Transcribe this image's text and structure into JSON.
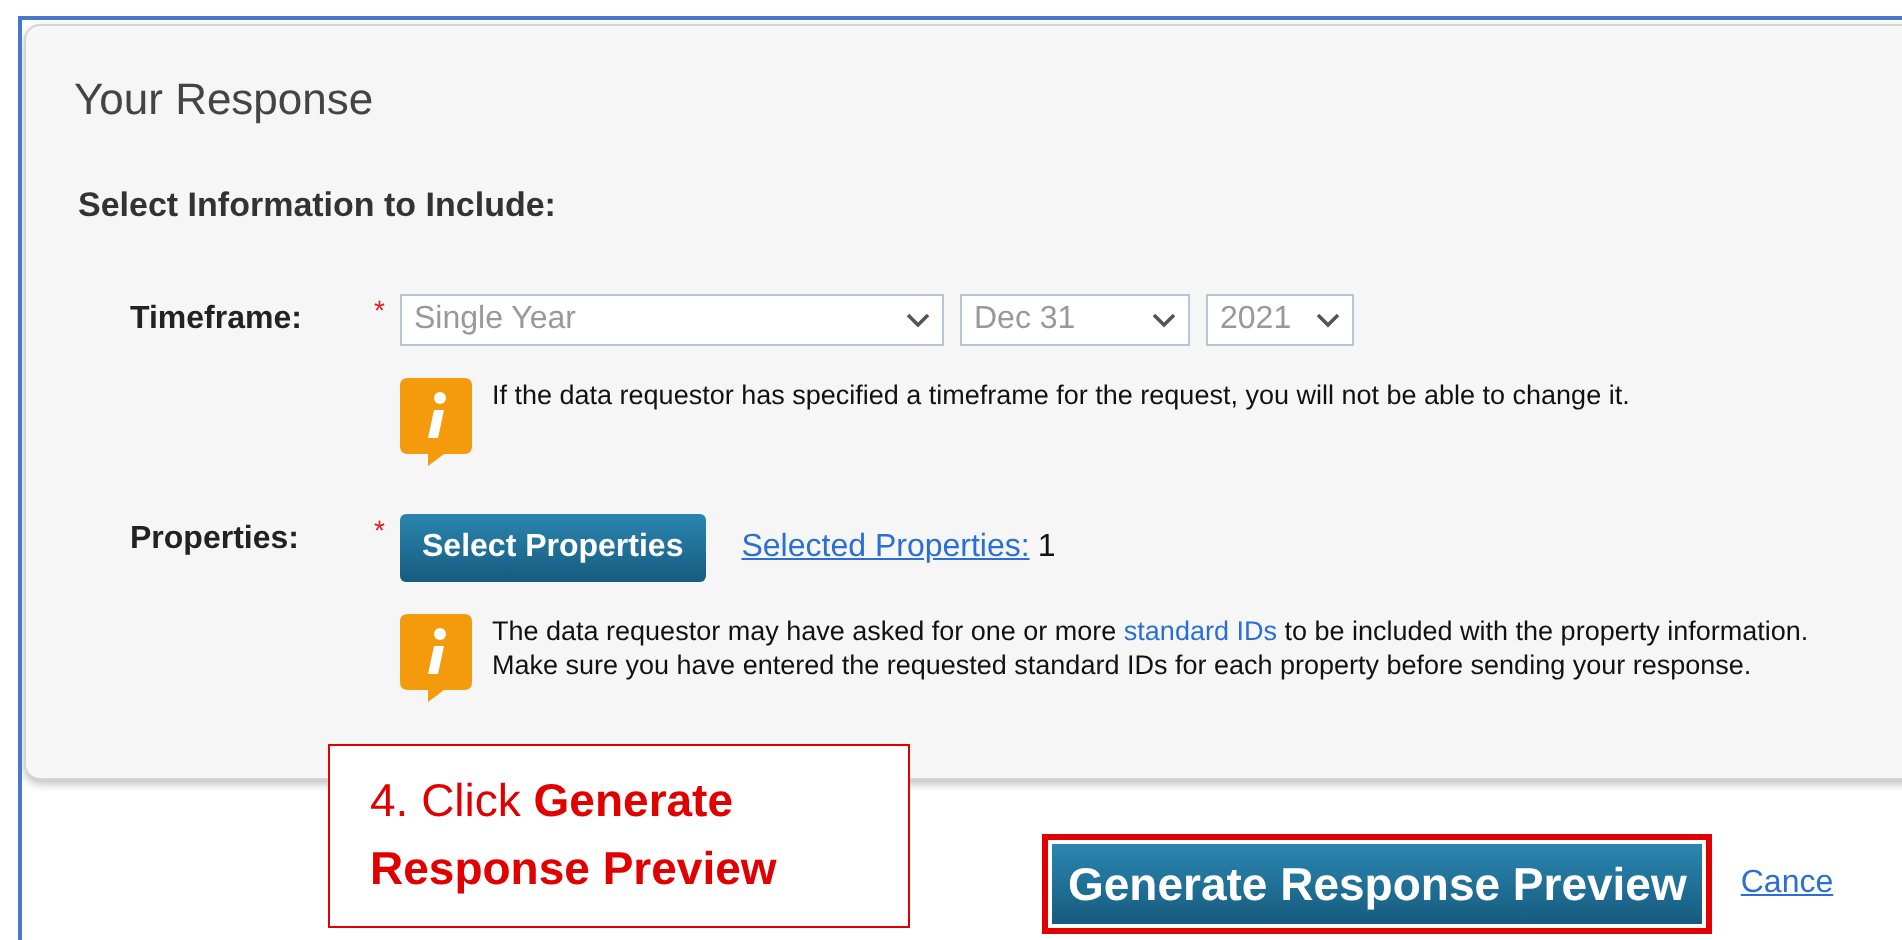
{
  "panel": {
    "title": "Your Response",
    "section_title": "Select Information to Include:"
  },
  "timeframe": {
    "label": "Timeframe:",
    "required_mark": "*",
    "selects": [
      {
        "value": "Single Year",
        "disabled": true
      },
      {
        "value": "Dec 31",
        "disabled": true
      },
      {
        "value": "2021",
        "disabled": true
      }
    ],
    "info": {
      "text_before": "If the data requestor has specified a timeframe for the request, you will not be able to change it."
    }
  },
  "properties": {
    "label": "Properties:",
    "required_mark": "*",
    "button": "Select Properties",
    "selected_link": "Selected Properties:",
    "selected_count": "1",
    "info": {
      "text_before": "The data requestor may have asked for one or more ",
      "link": "standard IDs",
      "text_after": " to be included with the property information. Make sure you have entered the requested standard IDs for each property before sending your response."
    }
  },
  "callout": "4. Click **Generate Response Preview**",
  "actions": {
    "primary": "Generate Response Preview",
    "secondary": "Cance"
  }
}
